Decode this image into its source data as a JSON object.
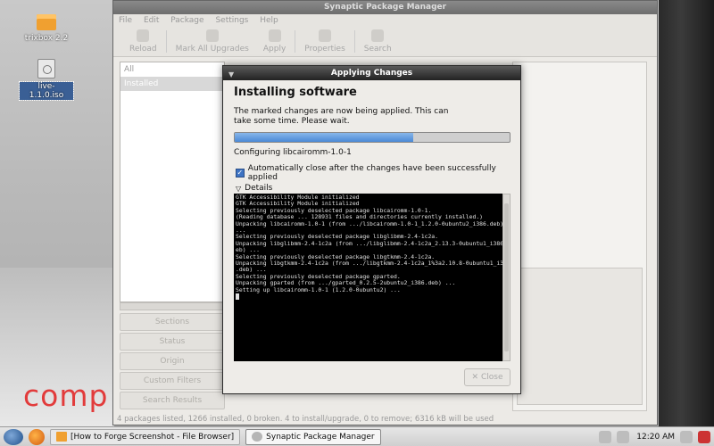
{
  "desktop": {
    "icons": [
      {
        "label": "trixbox 2.2"
      },
      {
        "label": "live-1.1.0.iso"
      }
    ],
    "brand_text": "comp"
  },
  "synaptic": {
    "title": "Synaptic Package Manager",
    "menu": [
      "File",
      "Edit",
      "Package",
      "Settings",
      "Help"
    ],
    "toolbar": [
      "Reload",
      "Mark All Upgrades",
      "Apply",
      "Properties",
      "Search"
    ],
    "filters": [
      "All",
      "Installed"
    ],
    "side_buttons": [
      "Sections",
      "Status",
      "Origin",
      "Custom Filters",
      "Search Results"
    ],
    "status": "4 packages listed, 1266 installed, 0 broken. 4 to install/upgrade, 0 to remove; 6316 kB will be used"
  },
  "dialog": {
    "title": "Applying Changes",
    "heading": "Installing software",
    "message": "The marked changes are now being applied. This can take some time. Please wait.",
    "progress_fraction": 0.65,
    "progress_label": "Configuring libcairomm-1.0-1",
    "auto_close_label": "Automatically close after the changes have been successfully applied",
    "auto_close_checked": true,
    "details_label": "Details",
    "terminal_lines": [
      "GTK Accessibility Module initialized",
      "GTK Accessibility Module initialized",
      "Selecting previously deselected package libcairomm-1.0-1.",
      "(Reading database ... 128931 files and directories currently installed.)",
      "Unpacking libcairomm-1.0-1 (from .../libcairomm-1.0-1_1.2.0-0ubuntu2_i386.deb)",
      "...",
      "Selecting previously deselected package libglibmm-2.4-1c2a.",
      "Unpacking libglibmm-2.4-1c2a (from .../libglibmm-2.4-1c2a_2.13.3-0ubuntu1_i386.d",
      "eb) ...",
      "Selecting previously deselected package libgtkmm-2.4-1c2a.",
      "Unpacking libgtkmm-2.4-1c2a (from .../libgtkmm-2.4-1c2a_1%3a2.10.8-0ubuntu1_i386",
      ".deb) ...",
      "Selecting previously deselected package gparted.",
      "Unpacking gparted (from .../gparted_0.2.5-2ubuntu2_i386.deb) ...",
      "Setting up libcairomm-1.0-1 (1.2.0-0ubuntu2) ..."
    ],
    "close_label": "Close"
  },
  "taskbar": {
    "tasks": [
      {
        "label": "[How to Forge Screenshot - File Browser]"
      },
      {
        "label": "Synaptic Package Manager"
      }
    ],
    "clock": "12:20 AM"
  },
  "colors": {
    "progress_fill": "#4a89d6",
    "dialog_title_bg": "#222222",
    "brand_red": "#e23b3b"
  }
}
